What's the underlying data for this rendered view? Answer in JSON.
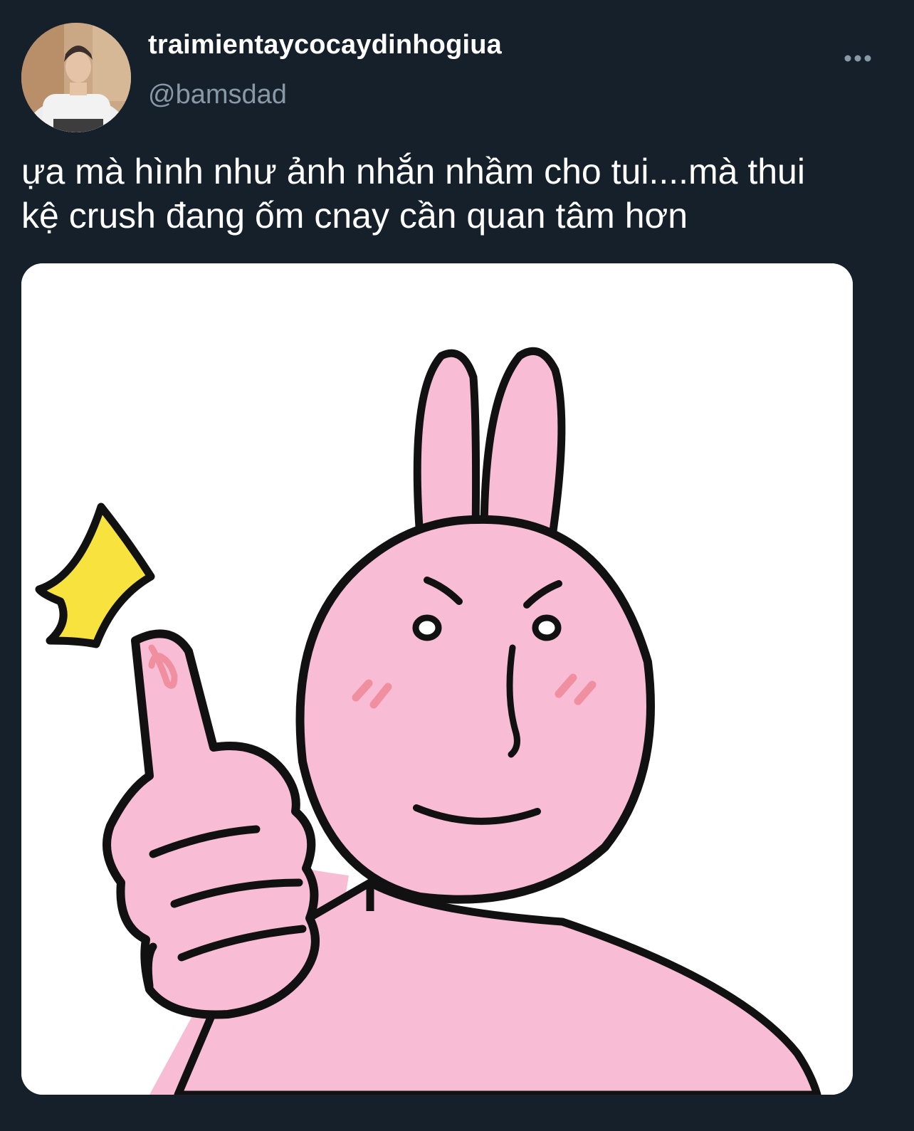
{
  "tweet": {
    "author": {
      "display_name": "traimientaycocaydinhogiua",
      "handle": "@bamsdad",
      "avatar_icon": "profile-photo"
    },
    "more_icon": "more-horizontal-icon",
    "text": "ựa mà hình như ảnh nhắn nhầm cho tui....mà thui\nkệ crush đang ốm cnay cần quan tâm hơn",
    "media": {
      "kind": "sticker",
      "subject": "pink-bunny-thumbs-up",
      "colors": {
        "bunny_fill": "#f8bcd4",
        "outline": "#111111",
        "star": "#f7e23e",
        "blush": "#f08fa0",
        "background": "#ffffff"
      }
    },
    "colors": {
      "background": "#15202b",
      "text": "#ffffff",
      "secondary_text": "#8899a6"
    }
  }
}
